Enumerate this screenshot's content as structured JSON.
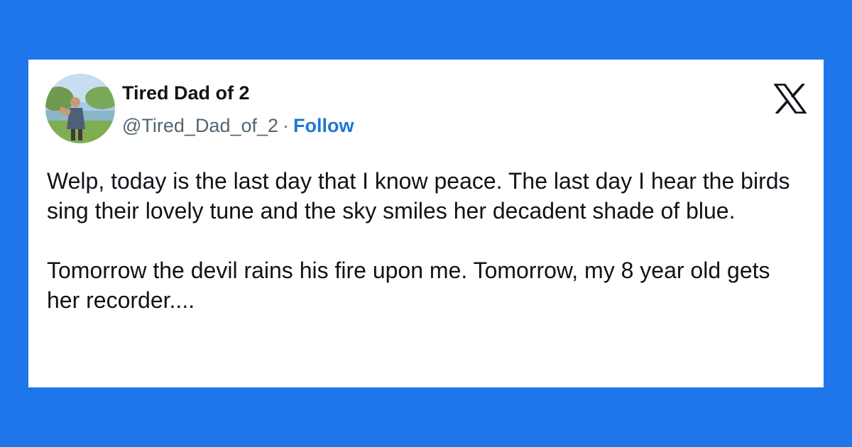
{
  "author": {
    "display_name": "Tired Dad of 2",
    "handle": "@Tired_Dad_of_2",
    "separator": "·",
    "follow_label": "Follow"
  },
  "icons": {
    "platform_logo": "x-logo-icon",
    "avatar": "profile-photo"
  },
  "tweet": {
    "paragraphs": [
      "Welp, today is the last day that I know peace. The last day I hear the birds sing their lovely tune and the sky smiles her decadent shade of blue.",
      "Tomorrow the devil rains his fire upon me. Tomorrow, my 8 year old gets her recorder...."
    ]
  },
  "colors": {
    "background": "#1f76ea",
    "card": "#ffffff",
    "text": "#0f1419",
    "muted": "#536471",
    "follow": "#1d77d6"
  }
}
